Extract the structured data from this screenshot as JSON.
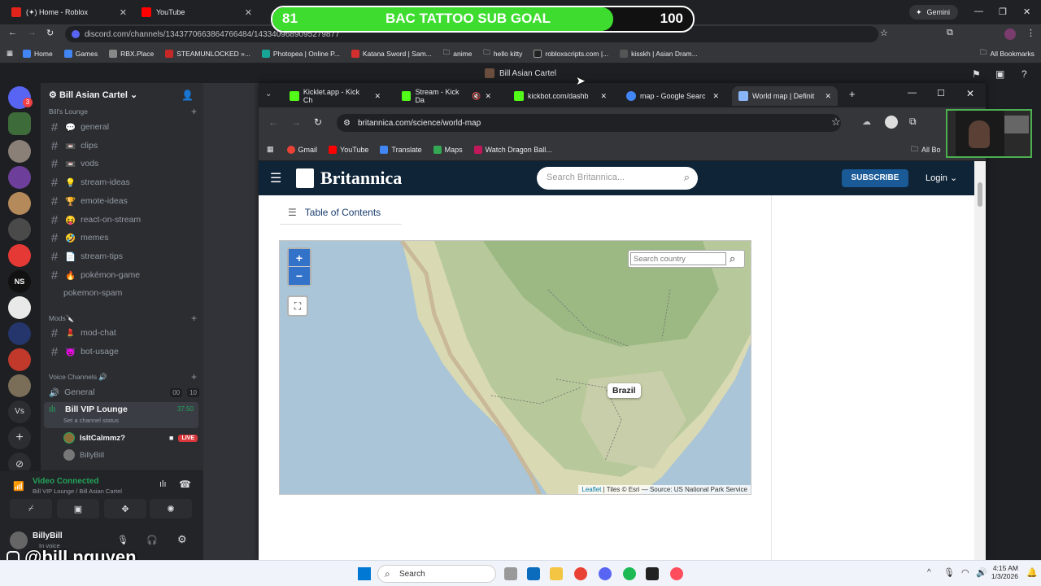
{
  "outer_tabs": [
    {
      "label": "(✦) Home - Roblox"
    },
    {
      "label": "YouTube"
    }
  ],
  "gemini": "Gemini",
  "outer_url": "discord.com/channels/1343770663864766484/1433409689095279877",
  "outer_bookmarks": [
    "Home",
    "Games",
    "RBX.Place",
    "STEAMUNLOCKED »...",
    "Photopea | Online P...",
    "Katana Sword | Sam...",
    "anime",
    "hello kitty",
    "robloxscripts.com |...",
    "kisskh | Asian Dram..."
  ],
  "all_bookmarks": "All Bookmarks",
  "discord": {
    "window_title": "Bill Asian Cartel",
    "dm_badge": "3",
    "server_name": "Bill Asian Cartel",
    "lounge_category": "Bill's Lounge",
    "channels": [
      "general",
      "clips",
      "vods",
      "stream-ideas",
      "emote-ideas",
      "react-on-stream",
      "memes",
      "stream-tips",
      "pokémon-game",
      "pokemon-spam"
    ],
    "channel_emojis": [
      "💬",
      "📼",
      "📼",
      "💡",
      "🏆",
      "😝",
      "🤣",
      "📄",
      "🔥",
      ""
    ],
    "mods_category": "Mods🔪",
    "mod_channels": [
      "mod-chat",
      "bot-usage"
    ],
    "mod_emojis": [
      "💄",
      "😈"
    ],
    "voice_category": "Voice Channels 🔊",
    "voice_general": "General",
    "voice_general_counts": [
      "00",
      "10"
    ],
    "vip_name": "Bill VIP Lounge",
    "vip_time": "37:50",
    "vip_status": "Set a channel status",
    "members": [
      {
        "name": "IsItCalmmz?",
        "live": "LIVE"
      },
      {
        "name": "BillyBill"
      }
    ],
    "connection": {
      "status": "Video Connected",
      "location": "Bill VIP Lounge / Bill Asian Cartel"
    },
    "user": {
      "name": "BillyBill",
      "status": "In voice"
    }
  },
  "inner_tabs": [
    {
      "label": "Kicklet.app - Kick Ch"
    },
    {
      "label": "Stream - Kick Da"
    },
    {
      "label": "kickbot.com/dashb"
    },
    {
      "label": "map - Google Searc"
    },
    {
      "label": "World map | Definit"
    }
  ],
  "inner_url": "britannica.com/science/world-map",
  "inner_bookmarks": [
    "Gmail",
    "YouTube",
    "Translate",
    "Maps",
    "Watch Dragon Ball..."
  ],
  "inner_all_bookmarks": "All Bo",
  "britannica": {
    "logo": "Britannica",
    "search_placeholder": "Search Britannica...",
    "subscribe": "SUBSCRIBE",
    "login": "Login",
    "toc": "Table of Contents",
    "map": {
      "zoom_in": "+",
      "zoom_out": "−",
      "search_placeholder": "Search country",
      "country_label": "Brazil",
      "attribution_link": "Leaflet",
      "attribution_text": " | Tiles © Esri — Source: US National Park Service"
    }
  },
  "stream_overlay": {
    "goal_start": "81",
    "goal_title": "BAC TATTOO SUB GOAL",
    "goal_end": "100",
    "goal_progress": 0.81,
    "instagram": "@bill.nguyen"
  },
  "taskbar": {
    "search": "Search",
    "time": "4:15 AM",
    "date": "1/3/2026"
  },
  "colors": {
    "goal_fill": "#3ddc2f",
    "britannica_header": "#0f2437",
    "subscribe_button": "#1a5a96",
    "discord_live": "#da373c"
  }
}
